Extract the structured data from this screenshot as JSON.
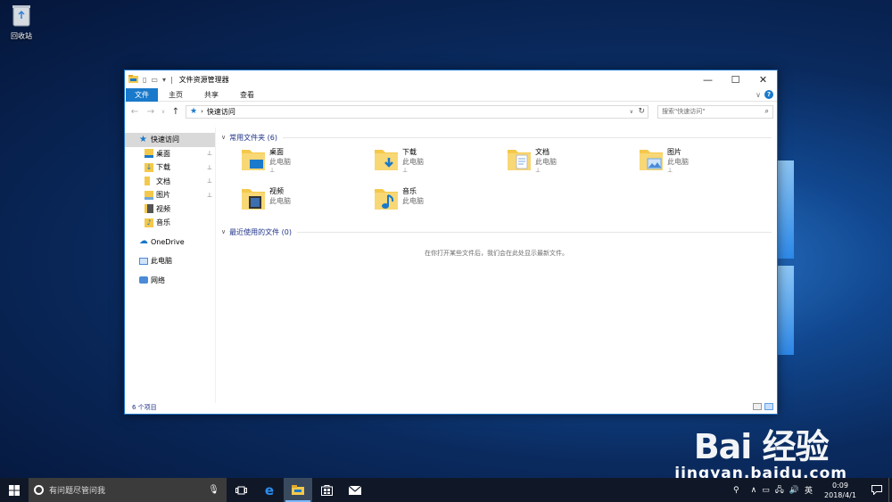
{
  "desktop": {
    "recycle_bin_label": "回收站"
  },
  "window": {
    "title": "文件资源管理器",
    "controls": {
      "minimize": "—",
      "maximize": "☐",
      "close": "✕"
    },
    "ribbon_tabs": [
      "文件",
      "主页",
      "共享",
      "查看"
    ],
    "address_path": "快速访问",
    "search_placeholder": "搜索\"快速访问\"",
    "nav": {
      "quick_access": "快速访问",
      "pinned": [
        {
          "label": "桌面",
          "icon": "desktop-folder-icon",
          "pinned": true
        },
        {
          "label": "下载",
          "icon": "download-folder-icon",
          "pinned": true
        },
        {
          "label": "文档",
          "icon": "documents-folder-icon",
          "pinned": true
        },
        {
          "label": "图片",
          "icon": "pictures-folder-icon",
          "pinned": true
        },
        {
          "label": "视频",
          "icon": "videos-folder-icon",
          "pinned": false
        },
        {
          "label": "音乐",
          "icon": "music-folder-icon",
          "pinned": false
        }
      ],
      "onedrive": "OneDrive",
      "this_pc": "此电脑",
      "network": "网络"
    },
    "frequent": {
      "header": "常用文件夹 (6)",
      "folders": [
        {
          "name": "桌面",
          "location": "此电脑",
          "pinned": true
        },
        {
          "name": "下载",
          "location": "此电脑",
          "pinned": true
        },
        {
          "name": "文档",
          "location": "此电脑",
          "pinned": true
        },
        {
          "name": "图片",
          "location": "此电脑",
          "pinned": true
        },
        {
          "name": "视频",
          "location": "此电脑",
          "pinned": false
        },
        {
          "name": "音乐",
          "location": "此电脑",
          "pinned": false
        }
      ]
    },
    "recent": {
      "header": "最近使用的文件 (0)",
      "empty_message": "在你打开某些文件后，我们会在此处显示最新文件。"
    },
    "status": "6 个项目"
  },
  "taskbar": {
    "search_placeholder": "有问题尽管问我",
    "ime": "英",
    "time": "0:09",
    "date": "2018/4/1"
  },
  "watermark": {
    "logo": "Bai 经验",
    "url": "jingyan.baidu.com"
  },
  "colors": {
    "accent": "#1979ca",
    "folder_yellow": "#f4c94b",
    "link_blue": "#1e3287"
  }
}
